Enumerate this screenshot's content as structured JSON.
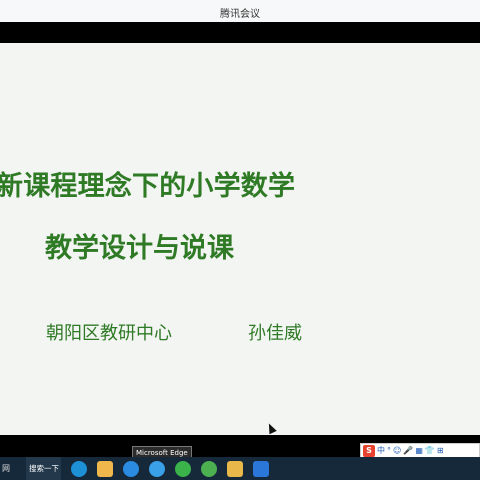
{
  "window": {
    "title": "腾讯会议"
  },
  "slide": {
    "title_line1": "新课程理念下的小学数学",
    "title_line2": "教学设计与说课",
    "organization": "朝阳区教研中心",
    "author": "孙佳威"
  },
  "tooltip": "Microsoft Edge",
  "ime": {
    "logo": "S",
    "items": [
      "中",
      "°",
      "☺",
      "🎤",
      "▦",
      "👕",
      "⊞"
    ]
  },
  "taskbar": {
    "left_label": "网",
    "search_label": "搜索一下",
    "apps": [
      {
        "name": "clock",
        "color": "#1e90d6"
      },
      {
        "name": "store",
        "color": "#f0b84c"
      },
      {
        "name": "edge",
        "color": "#2a8be0"
      },
      {
        "name": "sogou-browser",
        "color": "#3aa0e8"
      },
      {
        "name": "wechat",
        "color": "#3bb34a"
      },
      {
        "name": "360",
        "color": "#4caf50"
      },
      {
        "name": "file-explorer",
        "color": "#e8b84a"
      },
      {
        "name": "tencent-meeting",
        "color": "#2b77d9"
      }
    ]
  }
}
